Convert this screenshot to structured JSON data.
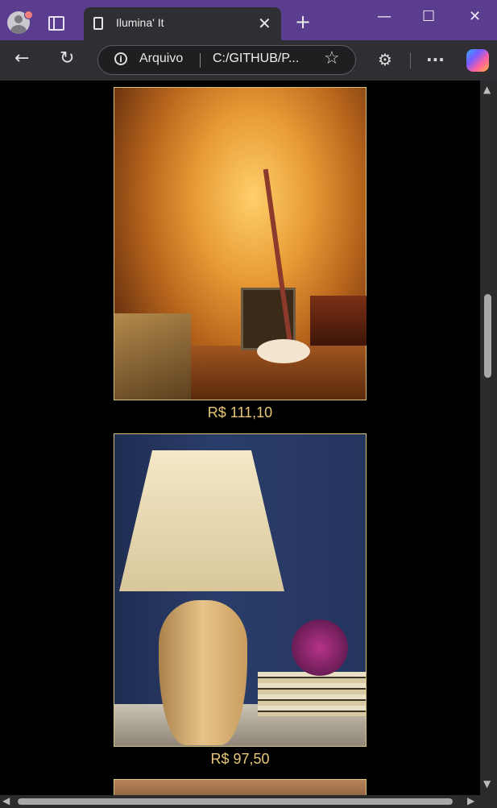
{
  "browser": {
    "tab_title": "Ilumina' It",
    "tab_close": "✕",
    "new_tab": "+",
    "window_controls": {
      "minimize": "—",
      "maximize": "☐",
      "close": "✕"
    },
    "address": {
      "security_label": "Arquivo",
      "url": "C:/GITHUB/P...",
      "info_icon": "i"
    },
    "icons": {
      "back": "←",
      "reload": "↻",
      "favorite": "☆",
      "extensions": "⚙",
      "more": "···"
    }
  },
  "products": [
    {
      "image_name": "fairy-light-tree-lamp",
      "price": "R$ 111,10"
    },
    {
      "image_name": "ceramic-table-lamp",
      "price": "R$ 97,50"
    }
  ],
  "scrollbar": {
    "up": "▲",
    "down": "▼",
    "left": "◀",
    "right": "▶"
  },
  "colors": {
    "accent": "#5b3d8f",
    "price": "#e8c877",
    "page_bg": "#000000",
    "card_border": "#d9c27a"
  }
}
